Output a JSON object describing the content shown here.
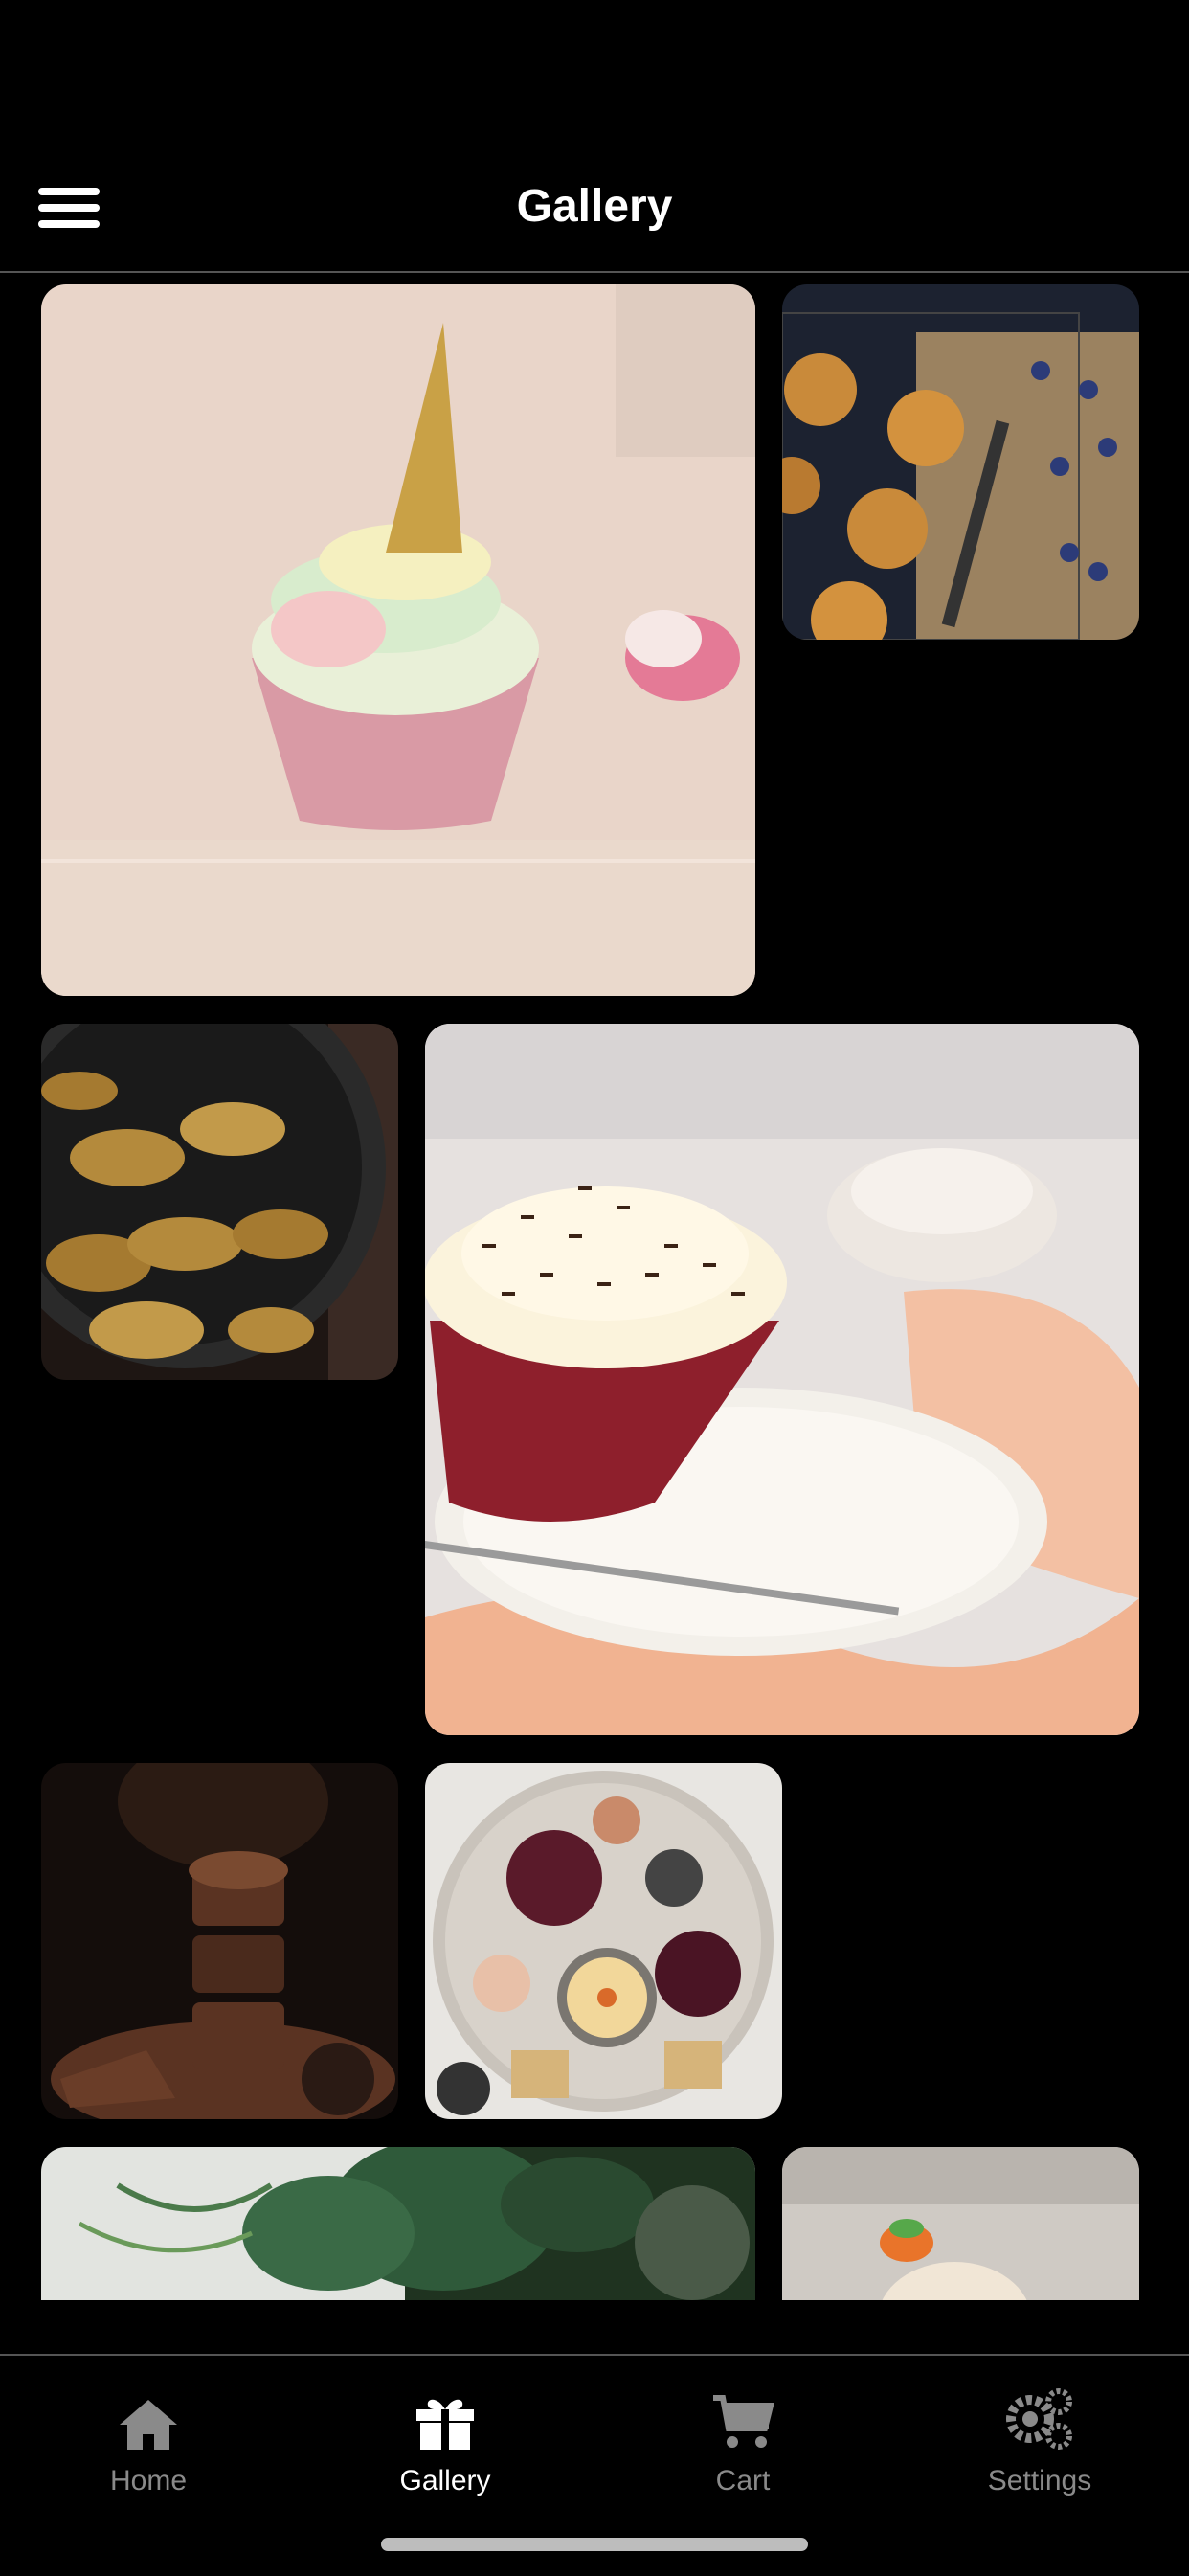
{
  "header": {
    "title": "Gallery",
    "menu_icon": "hamburger-menu-icon"
  },
  "gallery": {
    "items": [
      {
        "subject": "unicorn cupcake"
      },
      {
        "subject": "blueberry muffins"
      },
      {
        "subject": "chanterelle mushrooms"
      },
      {
        "subject": "red velvet cupcake"
      },
      {
        "subject": "chocolate cupcake stack"
      },
      {
        "subject": "charcuterie board"
      },
      {
        "subject": "green plant"
      },
      {
        "subject": "cupcake"
      }
    ]
  },
  "tabs": [
    {
      "label": "Home",
      "icon": "home-icon",
      "active": false
    },
    {
      "label": "Gallery",
      "icon": "gift-icon",
      "active": true
    },
    {
      "label": "Cart",
      "icon": "cart-icon",
      "active": false
    },
    {
      "label": "Settings",
      "icon": "gear-icon",
      "active": false
    }
  ],
  "colors": {
    "background": "#000000",
    "active_tab": "#ffffff",
    "inactive_tab": "#8a8a8a"
  }
}
